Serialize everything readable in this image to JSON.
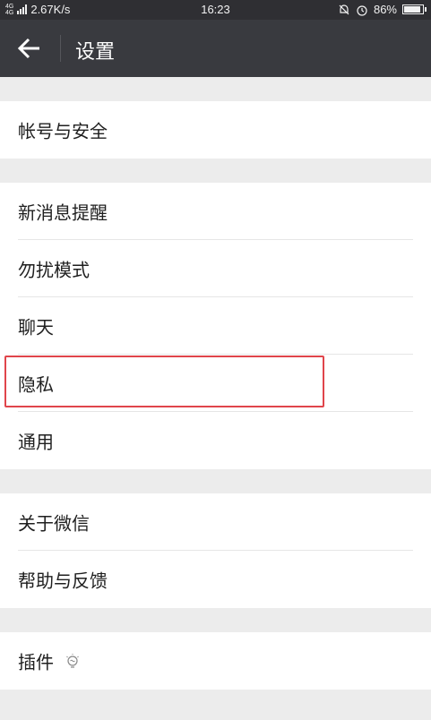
{
  "status_bar": {
    "network_top": "4G",
    "network_bottom": "4G",
    "speed": "2.67K/s",
    "time": "16:23",
    "battery": "86%"
  },
  "header": {
    "title": "设置",
    "back_icon": "back-arrow-icon"
  },
  "groups": [
    {
      "items": [
        {
          "label": "帐号与安全"
        }
      ]
    },
    {
      "items": [
        {
          "label": "新消息提醒"
        },
        {
          "label": "勿扰模式"
        },
        {
          "label": "聊天"
        },
        {
          "label": "隐私"
        },
        {
          "label": "通用"
        }
      ]
    },
    {
      "items": [
        {
          "label": "关于微信"
        },
        {
          "label": "帮助与反馈"
        }
      ]
    },
    {
      "items": [
        {
          "label": "插件",
          "icon": "bulb-icon"
        }
      ]
    }
  ],
  "highlight_color": "#e0454b"
}
